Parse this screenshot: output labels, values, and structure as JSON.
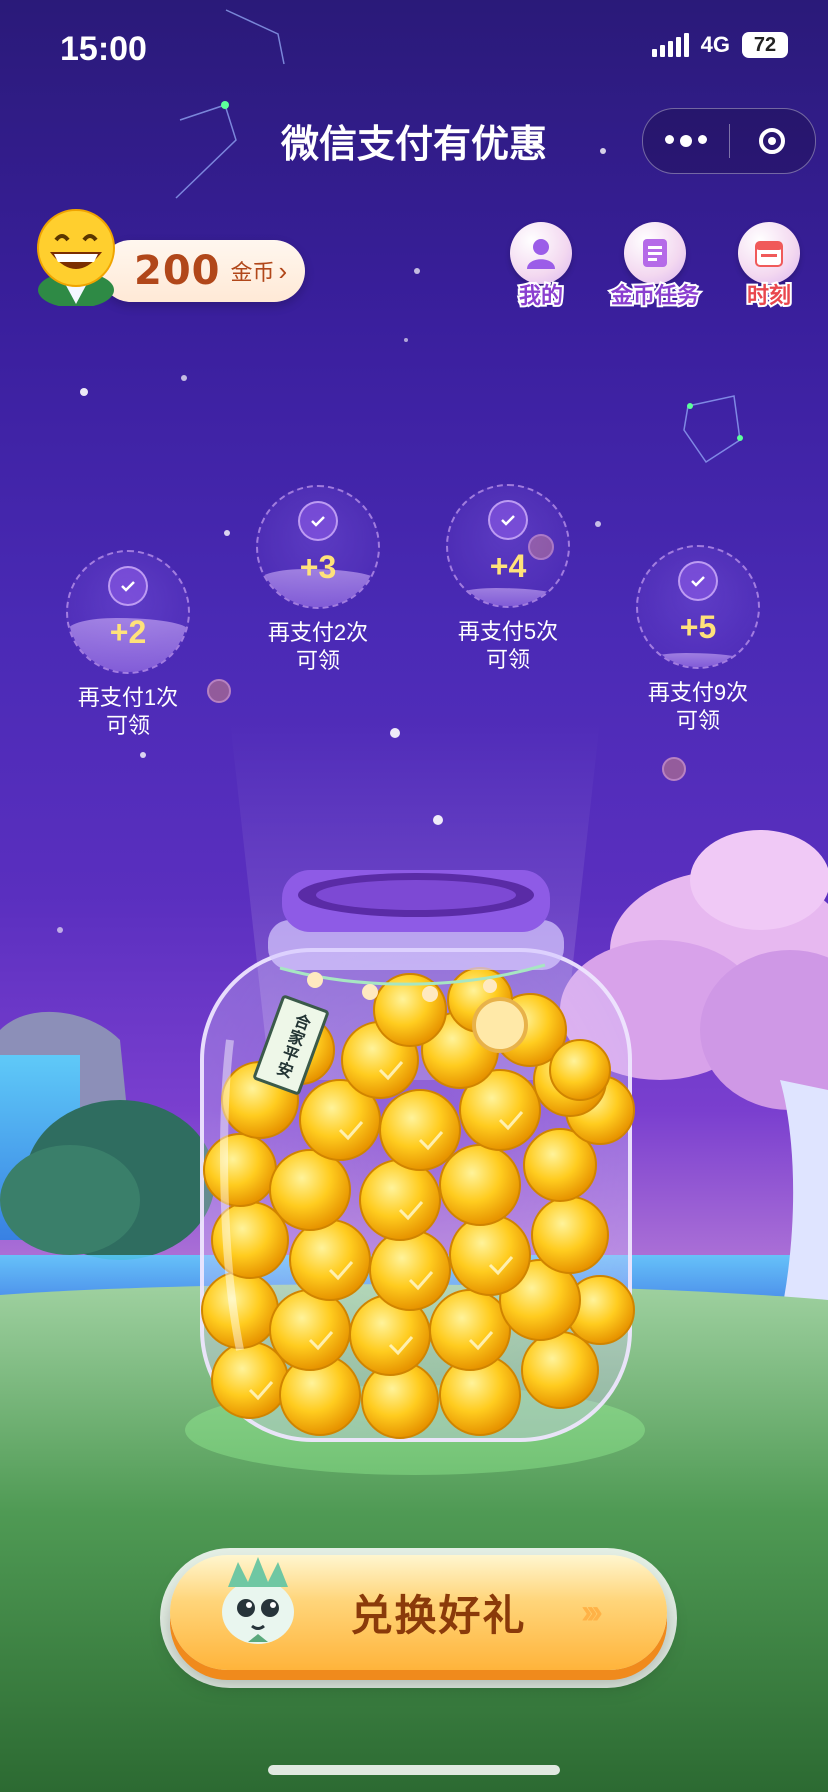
{
  "status_bar": {
    "time": "15:00",
    "network": "4G",
    "battery": "72"
  },
  "header": {
    "title": "微信支付有优惠"
  },
  "coins": {
    "amount": "200",
    "unit": "金币",
    "chevron": "›"
  },
  "top_actions": [
    {
      "label": "我的",
      "icon": "user-icon"
    },
    {
      "label": "金币任务",
      "icon": "task-list-icon"
    },
    {
      "label": "时刻",
      "icon": "calendar-icon"
    }
  ],
  "bonus_bubbles": [
    {
      "amount": "+2",
      "caption_line1": "再支付1次",
      "caption_line2": "可领",
      "fill": 0.45
    },
    {
      "amount": "+3",
      "caption_line1": "再支付2次",
      "caption_line2": "可领",
      "fill": 0.32
    },
    {
      "amount": "+4",
      "caption_line1": "再支付5次",
      "caption_line2": "可领",
      "fill": 0.15
    },
    {
      "amount": "+5",
      "caption_line1": "再支付9次",
      "caption_line2": "可领",
      "fill": 0.12
    }
  ],
  "jar": {
    "tag_text": "合家平安"
  },
  "cta": {
    "label": "兑换好礼",
    "arrows": "›››"
  },
  "colors": {
    "coin_text": "#b1471a",
    "bubble_amount": "#ffe27a",
    "cta_text": "#8a3a0a",
    "label_purple": "#8a3fd0",
    "label_red": "#e9474d"
  }
}
